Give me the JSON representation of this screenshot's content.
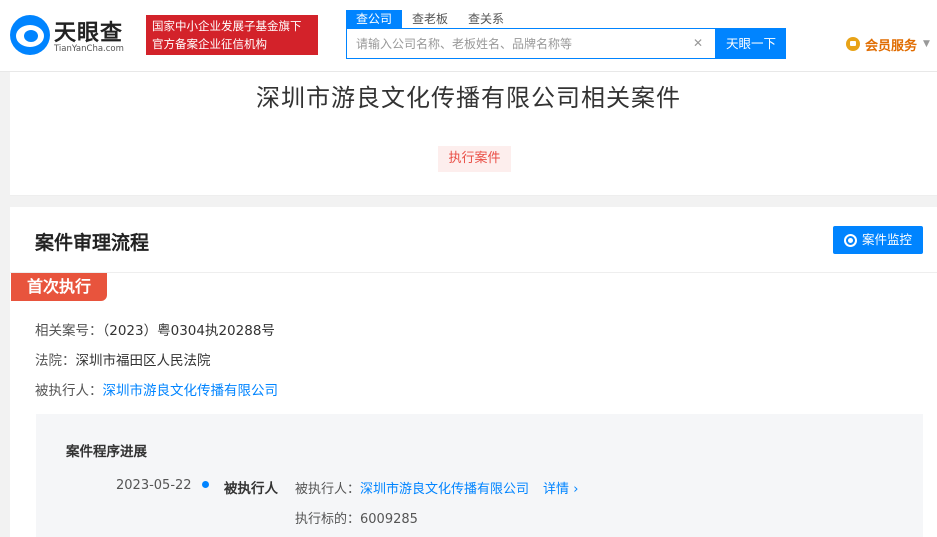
{
  "header": {
    "logo_cn": "天眼查",
    "logo_en": "TianYanCha.com",
    "badge_line1": "国家中小企业发展子基金旗下",
    "badge_line2": "官方备案企业征信机构",
    "tabs": [
      {
        "label": "查公司"
      },
      {
        "label": "查老板"
      },
      {
        "label": "查关系"
      }
    ],
    "search_placeholder": "请输入公司名称、老板姓名、品牌名称等",
    "search_button": "天眼一下",
    "vip_label": "会员服务"
  },
  "title_card": {
    "title": "深圳市游良文化传播有限公司相关案件",
    "tag": "执行案件"
  },
  "process": {
    "section_title": "案件审理流程",
    "monitor_button": "案件监控",
    "ribbon": "首次执行",
    "case_no_label": "相关案号：",
    "case_no": "（2023）粤0304执20288号",
    "court_label": "法院：",
    "court": "深圳市福田区人民法院",
    "executee_label": "被执行人：",
    "executee": "深圳市游良文化传播有限公司",
    "progress": {
      "title": "案件程序进展",
      "date": "2023-05-22",
      "role": "被执行人",
      "detail_label": "被执行人：",
      "detail_link": "深圳市游良文化传播有限公司",
      "more": "详情",
      "amount_label": "执行标的：",
      "amount": "6009285"
    }
  },
  "colors": {
    "brand_blue": "#0084ff",
    "badge_red": "#d3222a",
    "ribbon_red": "#e8543d",
    "tag_red": "#e94e45"
  }
}
